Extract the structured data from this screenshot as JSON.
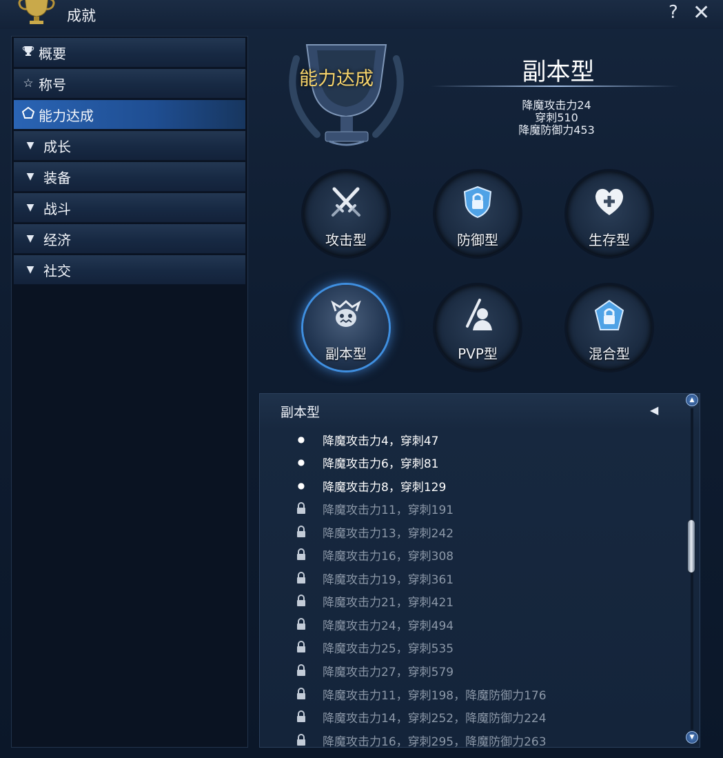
{
  "window": {
    "title": "成就"
  },
  "sidebar": {
    "items": [
      {
        "label": "概要",
        "icon": "trophy-icon"
      },
      {
        "label": "称号",
        "icon": "star-outline-icon"
      },
      {
        "label": "能力达成",
        "icon": "pentagon-icon",
        "active": true
      },
      {
        "label": "成长",
        "icon": "triangle-down-icon"
      },
      {
        "label": "装备",
        "icon": "triangle-down-icon"
      },
      {
        "label": "战斗",
        "icon": "triangle-down-icon"
      },
      {
        "label": "经济",
        "icon": "triangle-down-icon"
      },
      {
        "label": "社交",
        "icon": "triangle-down-icon"
      }
    ]
  },
  "header": {
    "category": "能力达成",
    "type_title": "副本型",
    "stats": [
      "降魔攻击力24",
      "穿刺510",
      "降魔防御力453"
    ]
  },
  "types": [
    {
      "label": "攻击型",
      "icon": "crossed-swords-icon"
    },
    {
      "label": "防御型",
      "icon": "shield-lock-icon"
    },
    {
      "label": "生存型",
      "icon": "heart-plus-icon"
    },
    {
      "label": "副本型",
      "icon": "monster-face-icon",
      "active": true
    },
    {
      "label": "PVP型",
      "icon": "pvp-figure-icon"
    },
    {
      "label": "混合型",
      "icon": "hybrid-lock-icon"
    }
  ],
  "list": {
    "title": "副本型",
    "rows": [
      {
        "text": "降魔攻击力4，穿刺47",
        "status": "done"
      },
      {
        "text": "降魔攻击力6，穿刺81",
        "status": "done"
      },
      {
        "text": "降魔攻击力8，穿刺129",
        "status": "done"
      },
      {
        "text": "降魔攻击力11，穿刺191",
        "status": "locked"
      },
      {
        "text": "降魔攻击力13，穿刺242",
        "status": "locked"
      },
      {
        "text": "降魔攻击力16，穿刺308",
        "status": "locked"
      },
      {
        "text": "降魔攻击力19，穿刺361",
        "status": "locked"
      },
      {
        "text": "降魔攻击力21，穿刺421",
        "status": "locked"
      },
      {
        "text": "降魔攻击力24，穿刺494",
        "status": "locked"
      },
      {
        "text": "降魔攻击力25，穿刺535",
        "status": "locked"
      },
      {
        "text": "降魔攻击力27，穿刺579",
        "status": "locked"
      },
      {
        "text": "降魔攻击力11，穿刺198，降魔防御力176",
        "status": "locked"
      },
      {
        "text": "降魔攻击力14，穿刺252，降魔防御力224",
        "status": "locked"
      },
      {
        "text": "降魔攻击力16，穿刺295，降魔防御力263",
        "status": "locked"
      }
    ]
  },
  "colors": {
    "accent": "#2a64b4",
    "gold_text": "#f6d36a",
    "locked_text": "#8c98a8"
  }
}
